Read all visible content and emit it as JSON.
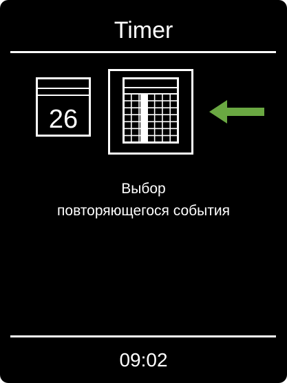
{
  "header": {
    "title": "Timer"
  },
  "options": [
    {
      "icon": "calendar-day-icon",
      "day": "26",
      "selected": false
    },
    {
      "icon": "calendar-grid-icon",
      "selected": true
    }
  ],
  "pointer": {
    "icon": "arrow-left-icon",
    "color": "#6aa842"
  },
  "message": {
    "line1": "Выбор",
    "line2": "повторяющегося события"
  },
  "footer": {
    "time": "09:02"
  },
  "colors": {
    "background": "#000000",
    "foreground": "#ffffff",
    "accent": "#6aa842"
  }
}
